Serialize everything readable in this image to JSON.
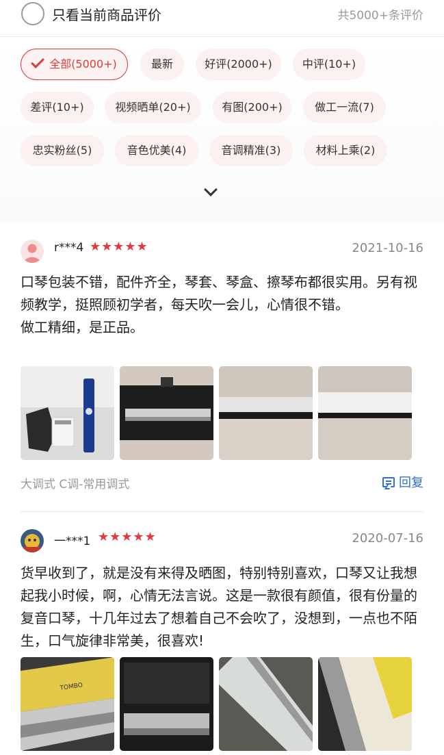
{
  "filter": {
    "only_current_label": "只看当前商品评价",
    "total_label": "共5000+条评价"
  },
  "tags": [
    {
      "label": "全部(5000+)",
      "active": true
    },
    {
      "label": "最新"
    },
    {
      "label": "好评(2000+)"
    },
    {
      "label": "中评(10+)"
    },
    {
      "label": "差评(10+)"
    },
    {
      "label": "视频晒单(20+)"
    },
    {
      "label": "有图(200+)"
    },
    {
      "label": "做工一流(7)"
    },
    {
      "label": "忠实粉丝(5)"
    },
    {
      "label": "音色优美(4)"
    },
    {
      "label": "音调精准(3)"
    },
    {
      "label": "材料上乘(2)"
    }
  ],
  "reviews": [
    {
      "username": "r***4",
      "stars": "★★★★★",
      "rating": 5,
      "date": "2021-10-16",
      "content": "口琴包装不错，配件齐全，琴套、琴盒、擦琴布都很实用。另有视频教学，挺照顾初学者，每天吹一会儿，心情很不错。\n做工精细，是正品。",
      "spec": "大调式 C调-常用调式",
      "reply_label": "回复"
    },
    {
      "username": "一***1",
      "stars": "★★★★★",
      "rating": 5,
      "date": "2020-07-16",
      "content": "货早收到了，就是没有来得及晒图，特别特别喜欢，口琴又让我想起我小时候，啊，心情无法言说。这是一款很有颜值，很有份量的复音口琴，十几年过去了想着自己不会吹了，没想到，一点也不陌生，口气旋律非常美，很喜欢!",
      "photo_brand_text": "TOMBO"
    }
  ]
}
